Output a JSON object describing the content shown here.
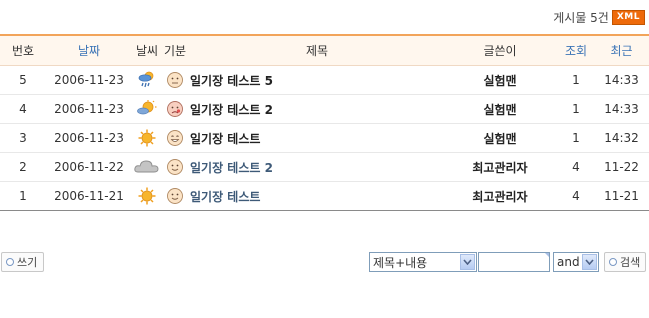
{
  "header": {
    "post_count": "게시물 5건",
    "rss_badge": "XML"
  },
  "columns": {
    "no": "번호",
    "date": "날짜",
    "weather": "날씨",
    "mood": "기분",
    "title": "제목",
    "author": "글쓴이",
    "views": "조회",
    "recent": "최근"
  },
  "rows": [
    {
      "no": "5",
      "date": "2006-11-23",
      "weather_icon": "sun-rain-icon",
      "mood_icon": "plain-face-icon",
      "title": "일기장 테스트 5",
      "author": "실험맨",
      "views": "1",
      "time": "14:33",
      "visited": false
    },
    {
      "no": "4",
      "date": "2006-11-23",
      "weather_icon": "sun-cloud-icon",
      "mood_icon": "sick-face-icon",
      "title": "일기장 테스트 2",
      "author": "실험맨",
      "views": "1",
      "time": "14:33",
      "visited": false
    },
    {
      "no": "3",
      "date": "2006-11-23",
      "weather_icon": "sun-icon",
      "mood_icon": "grin-face-icon",
      "title": "일기장 테스트",
      "author": "실험맨",
      "views": "1",
      "time": "14:32",
      "visited": false
    },
    {
      "no": "2",
      "date": "2006-11-22",
      "weather_icon": "cloud-icon",
      "mood_icon": "smile-face-icon",
      "title": "일기장 테스트 2",
      "author": "최고관리자",
      "views": "4",
      "time": "11-22",
      "visited": true
    },
    {
      "no": "1",
      "date": "2006-11-21",
      "weather_icon": "sun-icon",
      "mood_icon": "smile-face-icon",
      "title": "일기장 테스트",
      "author": "최고관리자",
      "views": "4",
      "time": "11-21",
      "visited": true
    }
  ],
  "footer": {
    "write_label": "쓰기",
    "search_field_value": "제목+내용",
    "search_input_value": "",
    "operator_value": "and",
    "search_label": "검색"
  }
}
